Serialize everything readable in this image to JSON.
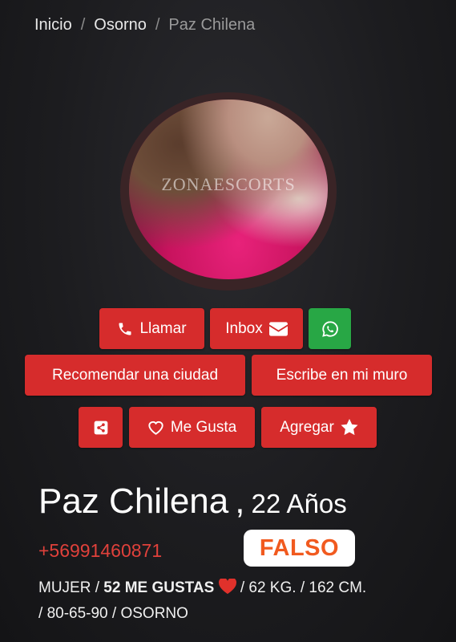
{
  "breadcrumb": {
    "items": [
      "Inicio",
      "Osorno",
      "Paz Chilena"
    ]
  },
  "avatar": {
    "watermark": "ZONAESCORTS"
  },
  "actions": {
    "call_label": "Llamar",
    "inbox_label": "Inbox",
    "recommend_city_label": "Recomendar una ciudad",
    "write_wall_label": "Escribe en mi muro",
    "like_label": "Me Gusta",
    "add_label": "Agregar"
  },
  "profile": {
    "name": "Paz Chilena",
    "separator": ",",
    "age": "22 Años",
    "phone": "+56991460871",
    "stamp": "FALSO",
    "gender": "MUJER",
    "likes": "52 ME GUSTAS",
    "weight": "62 KG.",
    "height": "162 CM.",
    "measurements": "80-65-90",
    "city": "OSORNO"
  },
  "colors": {
    "accent": "#d62c2c",
    "whatsapp": "#28a745",
    "phone": "#e0413b",
    "stamp_text": "#f15a1f",
    "background": "#1b1a1d"
  },
  "icons": {
    "call": "phone-icon",
    "inbox": "envelope-icon",
    "whatsapp": "whatsapp-icon",
    "share": "share-icon",
    "like": "heart-outline-icon",
    "add": "star-icon",
    "likes_heart": "heart-icon"
  }
}
